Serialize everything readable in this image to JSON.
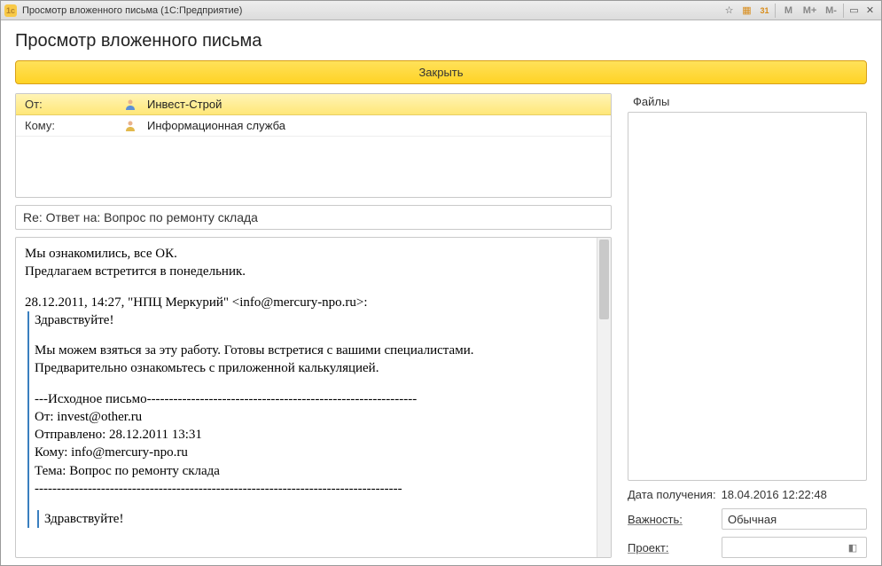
{
  "titlebar": {
    "icon_text": "1c",
    "title": "Просмотр вложенного письма  (1С:Предприятие)",
    "buttons": {
      "star": "☆",
      "calc": "▦",
      "cal": "31",
      "m": "M",
      "mplus": "M+",
      "mminus": "M-",
      "max": "▭",
      "close": "✕"
    }
  },
  "page": {
    "title": "Просмотр вложенного письма",
    "close_btn": "Закрыть"
  },
  "headers": {
    "from_label": "От:",
    "from_value": "Инвест-Строй",
    "to_label": "Кому:",
    "to_value": "Информационная служба"
  },
  "subject": "Re: Ответ на: Вопрос по ремонту склада",
  "body": {
    "l1": "Мы ознакомились, все ОК.",
    "l2": "Предлагаем встретится в понедельник.",
    "l3": "28.12.2011, 14:27, \"НПЦ Меркурий\" <info@mercury-npo.ru>:",
    "q1": "Здравствуйте!",
    "q2": "Мы можем взяться за эту работу. Готовы встретися с вашими специалистами.",
    "q3": "Предварительно ознакомьтесь с приложенной калькуляцией.",
    "q4": "---Исходное письмо-------------------------------------------------------------",
    "q5": "От: invest@other.ru",
    "q6": "Отправлено: 28.12.2011 13:31",
    "q7": "Кому: info@mercury-npo.ru",
    "q8": "Тема: Вопрос по ремонту склада",
    "q9": "-----------------------------------------------------------------------------------",
    "q10": "Здравствуйте!"
  },
  "side": {
    "files_label": "Файлы",
    "received_label": "Дата получения:",
    "received_value": "18.04.2016 12:22:48",
    "importance_label": "Важность:",
    "importance_value": "Обычная",
    "project_label": "Проект:",
    "project_value": ""
  }
}
